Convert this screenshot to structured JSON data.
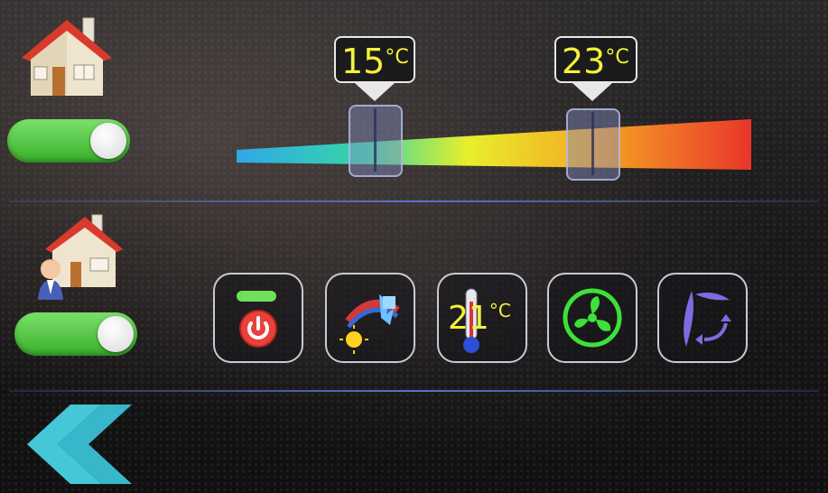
{
  "thermostat": {
    "min_setpoint": {
      "value": "15",
      "unit": "°C"
    },
    "max_setpoint": {
      "value": "23",
      "unit": "°C"
    }
  },
  "modes": {
    "current_temp": {
      "value": "21",
      "unit": "°C"
    }
  },
  "toggles": {
    "home_state": "on",
    "presence_state": "on"
  },
  "colors": {
    "accent_green": "#3bb12d",
    "label_yellow": "#f2f23a",
    "divider_blue": "#5b73c9",
    "back_cyan": "#45c7d8"
  },
  "icons": {
    "home": "house-icon",
    "presence": "house-person-icon",
    "power": "power-icon",
    "mode": "heat-cool-mode-icon",
    "thermometer": "thermometer-icon",
    "fan": "fan-icon",
    "swing": "swing-icon",
    "back": "double-chevron-left-icon"
  }
}
